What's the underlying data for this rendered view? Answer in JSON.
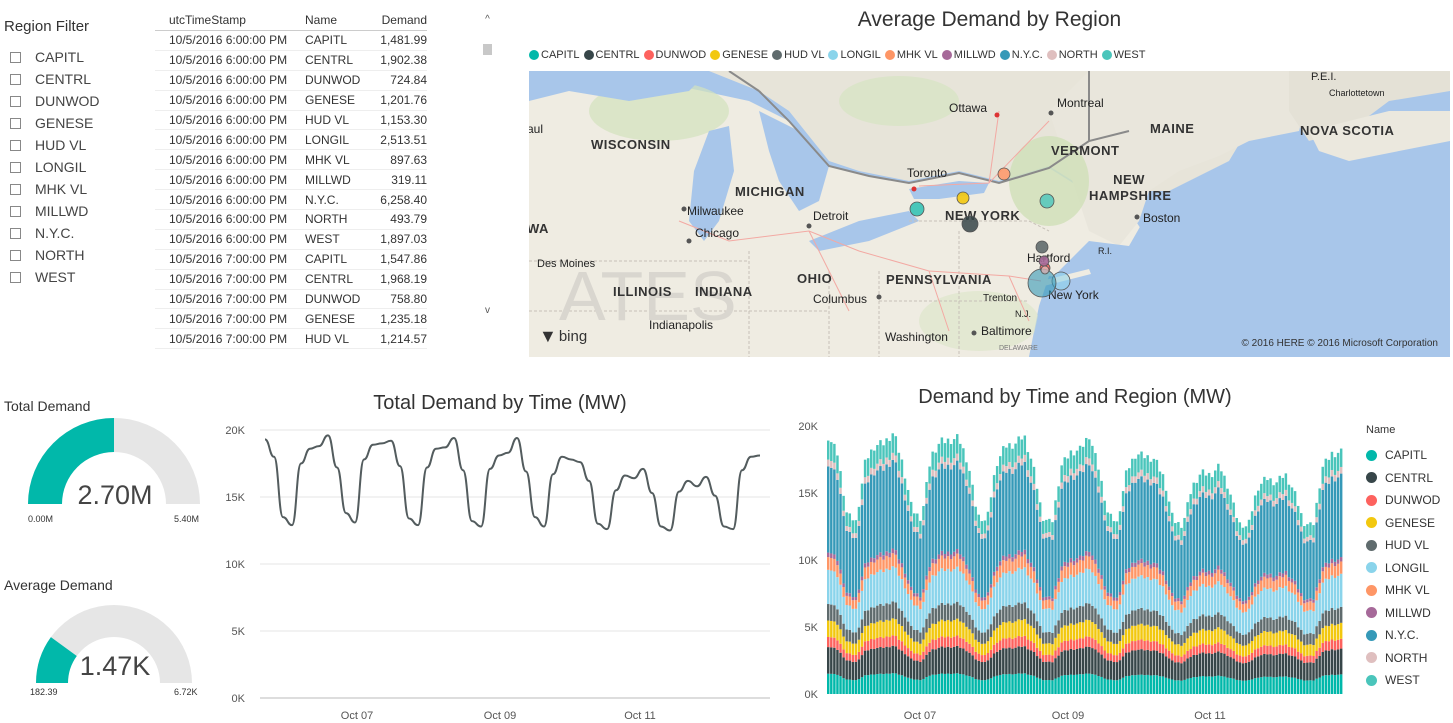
{
  "filter": {
    "title": "Region Filter",
    "items": [
      "CAPITL",
      "CENTRL",
      "DUNWOD",
      "GENESE",
      "HUD VL",
      "LONGIL",
      "MHK VL",
      "MILLWD",
      "N.Y.C.",
      "NORTH",
      "WEST"
    ]
  },
  "table": {
    "headers": [
      "utcTimeStamp",
      "Name",
      "Demand"
    ],
    "rows": [
      [
        "10/5/2016 6:00:00 PM",
        "CAPITL",
        "1,481.99"
      ],
      [
        "10/5/2016 6:00:00 PM",
        "CENTRL",
        "1,902.38"
      ],
      [
        "10/5/2016 6:00:00 PM",
        "DUNWOD",
        "724.84"
      ],
      [
        "10/5/2016 6:00:00 PM",
        "GENESE",
        "1,201.76"
      ],
      [
        "10/5/2016 6:00:00 PM",
        "HUD VL",
        "1,153.30"
      ],
      [
        "10/5/2016 6:00:00 PM",
        "LONGIL",
        "2,513.51"
      ],
      [
        "10/5/2016 6:00:00 PM",
        "MHK VL",
        "897.63"
      ],
      [
        "10/5/2016 6:00:00 PM",
        "MILLWD",
        "319.11"
      ],
      [
        "10/5/2016 6:00:00 PM",
        "N.Y.C.",
        "6,258.40"
      ],
      [
        "10/5/2016 6:00:00 PM",
        "NORTH",
        "493.79"
      ],
      [
        "10/5/2016 6:00:00 PM",
        "WEST",
        "1,897.03"
      ],
      [
        "10/5/2016 7:00:00 PM",
        "CAPITL",
        "1,547.86"
      ],
      [
        "10/5/2016 7:00:00 PM",
        "CENTRL",
        "1,968.19"
      ],
      [
        "10/5/2016 7:00:00 PM",
        "DUNWOD",
        "758.80"
      ],
      [
        "10/5/2016 7:00:00 PM",
        "GENESE",
        "1,235.18"
      ],
      [
        "10/5/2016 7:00:00 PM",
        "HUD VL",
        "1,214.57"
      ]
    ],
    "scroll_up": "^",
    "scroll_down": "v"
  },
  "map": {
    "title": "Average Demand by Region",
    "labels": {
      "wisconsin": "WISCONSIN",
      "michigan": "MICHIGAN",
      "ohio": "OHIO",
      "illinois": "ILLINOIS",
      "indiana": "INDIANA",
      "pennsylvania": "PENNSYLVANIA",
      "newyork": "NEW YORK",
      "vermont": "VERMONT",
      "newhampshire": "NEW HAMPSHIRE",
      "maine": "MAINE",
      "novascotia": "NOVA SCOTIA",
      "milwaukee": "Milwaukee",
      "chicago": "Chicago",
      "detroit": "Detroit",
      "toronto": "Toronto",
      "ottawa": "Ottawa",
      "montreal": "Montreal",
      "boston": "Boston",
      "hartford": "Hartford",
      "newyorkcity": "New York",
      "trenton": "Trenton",
      "baltimore": "Baltimore",
      "washington": "Washington",
      "columbus": "Columbus",
      "indianapolis": "Indianapolis",
      "desmoines": "Des Moines",
      "charlottetown": "Charlottetown",
      "pei": "P.E.I.",
      "wa": "WA",
      "aul": "aul",
      "ri": "R.I.",
      "nj": "N.J.",
      "delaware": "DELAWARE",
      "ates": "ATES"
    },
    "bing": "bing",
    "credit": "© 2016 HERE   © 2016 Microsoft Corporation"
  },
  "regions": [
    {
      "name": "CAPITL",
      "color": "#01b8aa"
    },
    {
      "name": "CENTRL",
      "color": "#374649"
    },
    {
      "name": "DUNWOD",
      "color": "#fd625e"
    },
    {
      "name": "GENESE",
      "color": "#f2c80f"
    },
    {
      "name": "HUD VL",
      "color": "#5f6b6d"
    },
    {
      "name": "LONGIL",
      "color": "#8ad4eb"
    },
    {
      "name": "MHK VL",
      "color": "#fe9666"
    },
    {
      "name": "MILLWD",
      "color": "#a66999"
    },
    {
      "name": "N.Y.C.",
      "color": "#3599b8"
    },
    {
      "name": "NORTH",
      "color": "#dfbfbf"
    },
    {
      "name": "WEST",
      "color": "#4ac5bb"
    }
  ],
  "gauges": [
    {
      "title": "Total Demand",
      "value": "2.70M",
      "min": "0.00M",
      "max": "5.40M",
      "fraction": 0.5,
      "color": "#01b8aa"
    },
    {
      "title": "Average Demand",
      "value": "1.47K",
      "min": "182.39",
      "max": "6.72K",
      "fraction": 0.2,
      "color": "#01b8aa"
    }
  ],
  "chart_data": [
    {
      "type": "line",
      "title": "Total Demand by Time (MW)",
      "x_ticks": [
        "Oct 07",
        "Oct 09",
        "Oct 11"
      ],
      "y_ticks": [
        "0K",
        "5K",
        "10K",
        "15K",
        "20K"
      ],
      "ylim": [
        0,
        20000
      ],
      "xlim": [
        "10/5/2016 6:00 PM",
        "10/12/2016 6:00 PM"
      ],
      "series": [
        {
          "values": [
            19300,
            18000,
            13500,
            12900,
            17500,
            18600,
            18800,
            19600,
            17200,
            13800,
            13100,
            17800,
            18900,
            19000,
            19200,
            17300,
            13400,
            12900,
            17200,
            18600,
            18700,
            19400,
            17000,
            13200,
            12800,
            17100,
            18100,
            18300,
            19400,
            16900,
            13500,
            12800,
            16700,
            18000,
            17800,
            17600,
            16200,
            13000,
            12600,
            15500,
            16600,
            16400,
            17100,
            15300,
            12800,
            12500,
            15400,
            16200,
            15800,
            16500,
            15100,
            12800,
            12600,
            17000,
            18000,
            18100
          ]
        }
      ]
    },
    {
      "type": "area",
      "title": "Demand by Time and Region (MW)",
      "x_ticks": [
        "Oct 07",
        "Oct 09",
        "Oct 11"
      ],
      "y_ticks": [
        "0K",
        "5K",
        "10K",
        "15K",
        "20K"
      ],
      "ylim": [
        0,
        20000
      ],
      "legend_title": "Name",
      "series_names": [
        "CAPITL",
        "CENTRL",
        "DUNWOD",
        "GENESE",
        "HUD VL",
        "LONGIL",
        "MHK VL",
        "MILLWD",
        "N.Y.C.",
        "NORTH",
        "WEST"
      ],
      "series_shares": [
        0.08,
        0.105,
        0.04,
        0.065,
        0.065,
        0.135,
        0.05,
        0.018,
        0.34,
        0.027,
        0.075
      ]
    }
  ]
}
